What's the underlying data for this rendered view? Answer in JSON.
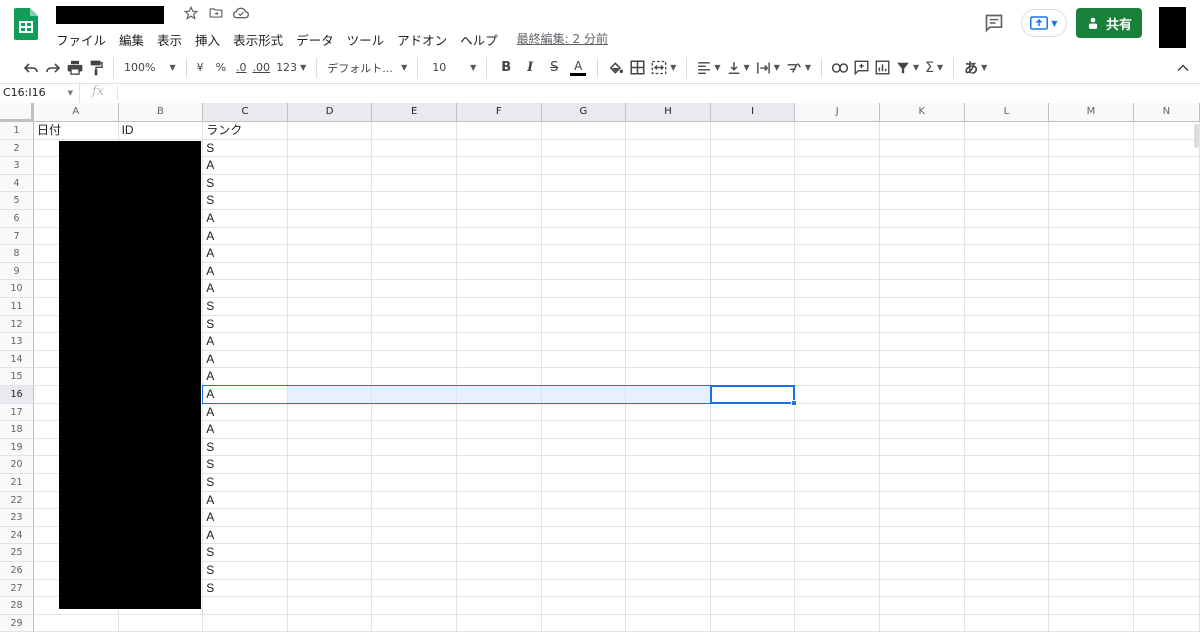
{
  "app": {
    "menu": [
      "ファイル",
      "編集",
      "表示",
      "挿入",
      "表示形式",
      "データ",
      "ツール",
      "アドオン",
      "ヘルプ"
    ],
    "last_edit": "最終編集: 2 分前",
    "share_label": "共有",
    "brand_color": "#188038"
  },
  "toolbar": {
    "zoom": "100%",
    "currency": "¥",
    "percent": "%",
    "decimal_decrease": ".0",
    "decimal_increase": ".00",
    "more_formats": "123",
    "font": "デフォルト...",
    "font_size": "10",
    "bold": "B",
    "italic": "I",
    "strike": "S",
    "text_color": "A",
    "input_tools": "あ",
    "sigma": "Σ"
  },
  "formula_bar": {
    "name_box": "C16:I16",
    "fx": "fx"
  },
  "grid": {
    "columns": [
      "A",
      "B",
      "C",
      "D",
      "E",
      "F",
      "G",
      "H",
      "I",
      "J",
      "K",
      "L",
      "M",
      "N"
    ],
    "rows": [
      "1",
      "2",
      "3",
      "4",
      "5",
      "6",
      "7",
      "8",
      "9",
      "10",
      "11",
      "12",
      "13",
      "14",
      "15",
      "16",
      "17",
      "18",
      "19",
      "20",
      "21",
      "22",
      "23",
      "24",
      "25",
      "26",
      "27",
      "28",
      "29"
    ],
    "header_row": [
      "日付",
      "ID",
      "ランク"
    ],
    "rank_values": [
      "S",
      "A",
      "S",
      "S",
      "A",
      "A",
      "A",
      "A",
      "A",
      "S",
      "S",
      "A",
      "A",
      "A",
      "A",
      "A",
      "A",
      "S",
      "S",
      "S",
      "A",
      "A",
      "A",
      "S",
      "S",
      "S"
    ],
    "selection": "C16:I16",
    "active_cell": "I16",
    "selection_color": "#1a73e8"
  }
}
